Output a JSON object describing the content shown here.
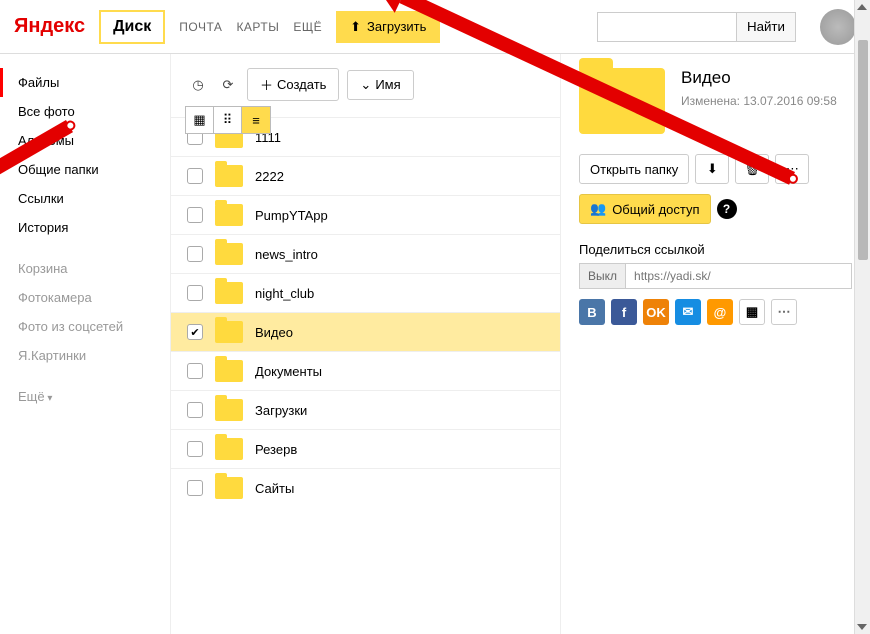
{
  "header": {
    "logo": "Яндекс",
    "service": "Диск",
    "nav": {
      "mail": "ПОЧТА",
      "maps": "КАРТЫ",
      "more": "ЕЩЁ"
    },
    "upload": "Загрузить",
    "search_btn": "Найти"
  },
  "sidebar": {
    "items": [
      {
        "label": "Файлы",
        "active": true
      },
      {
        "label": "Все фото"
      },
      {
        "label": "Альбомы"
      },
      {
        "label": "Общие папки"
      },
      {
        "label": "Ссылки"
      },
      {
        "label": "История"
      }
    ],
    "secondary": [
      {
        "label": "Корзина"
      },
      {
        "label": "Фотокамера"
      },
      {
        "label": "Фото из соцсетей"
      },
      {
        "label": "Я.Картинки"
      }
    ],
    "more": "Ещё"
  },
  "toolbar": {
    "create": "Создать",
    "sort": "Имя"
  },
  "files": [
    {
      "name": "1111",
      "checked": false
    },
    {
      "name": "2222",
      "checked": false
    },
    {
      "name": "PumpYTApp",
      "checked": false
    },
    {
      "name": "news_intro",
      "checked": false
    },
    {
      "name": "night_club",
      "checked": false
    },
    {
      "name": "Видео",
      "checked": true,
      "selected": true
    },
    {
      "name": "Документы",
      "checked": false
    },
    {
      "name": "Загрузки",
      "checked": false
    },
    {
      "name": "Резерв",
      "checked": false
    },
    {
      "name": "Сайты",
      "checked": false
    }
  ],
  "details": {
    "title": "Видео",
    "modified_label": "Изменена: 13.07.2016 09:58",
    "open": "Открыть папку",
    "share": "Общий доступ",
    "share_link_label": "Поделиться ссылкой",
    "toggle_off": "Выкл",
    "url_placeholder": "https://yadi.sk/"
  },
  "social": {
    "vk": "В",
    "fb": "f",
    "ok": "OK",
    "mail": "✉",
    "at": "@",
    "qr": "▦",
    "more": "⋯"
  }
}
